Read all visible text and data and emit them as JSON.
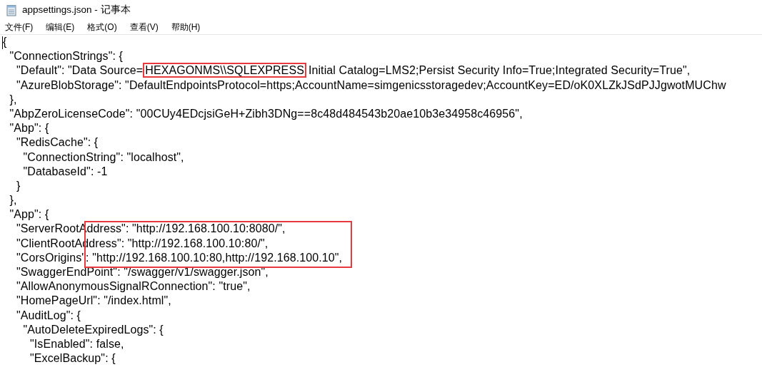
{
  "window": {
    "title": "appsettings.json - 记事本"
  },
  "menu": [
    "文件(F)",
    "编辑(E)",
    "格式(O)",
    "查看(V)",
    "帮助(H)"
  ],
  "editor": {
    "lines": [
      {
        "text": "{",
        "children": [
          {
            "text": "\"ConnectionStrings\": {",
            "children": [
              {
                "segments": [
                  {
                    "text": "\"Default\": \"Data Source=",
                    "boxed": false
                  },
                  {
                    "text": "HEXAGONMS\\\\SQLEXPRESS",
                    "boxed": true
                  },
                  {
                    "text": "Initial Catalog=LMS2;Persist Security Info=True;Integrated Security=True\",",
                    "boxed": false
                  }
                ]
              },
              {
                "text": "\"AzureBlobStorage\": \"DefaultEndpointsProtocol=https;AccountName=simgenicsstoragedev;AccountKey=ED/oK0XLZkJSdPJJgwotMUChw"
              }
            ]
          },
          {
            "text": "},"
          },
          {
            "text": "\"AbpZeroLicenseCode\": \"00CUy4EDcjsiGeH+Zibh3DNg==8c48d484543b20ae10b3e34958c46956\","
          },
          {
            "text": "\"Abp\": {",
            "children": [
              {
                "text": "\"RedisCache\": {",
                "children": [
                  {
                    "text": "\"ConnectionString\": \"localhost\","
                  },
                  {
                    "text": "\"DatabaseId\": -1"
                  }
                ]
              },
              {
                "text": "}"
              }
            ]
          },
          {
            "text": "},"
          },
          {
            "text": "\"App\": {",
            "children": [
              {
                "text": "\"ServerRootAddress\": \"http://192.168.100.10:8080/\",",
                "in_box": true
              },
              {
                "text": "\"ClientRootAddress\": \"http://192.168.100.10:80/\",",
                "in_box": true
              },
              {
                "text": "\"CorsOrigins\": \"http://192.168.100.10:80,http://192.168.100.10\",",
                "in_box": true
              },
              {
                "text": "\"SwaggerEndPoint\": \"/swagger/v1/swagger.json\","
              },
              {
                "text": "\"AllowAnonymousSignalRConnection\": \"true\","
              },
              {
                "text": "\"HomePageUrl\": \"/index.html\","
              },
              {
                "text": "\"AuditLog\": {",
                "children": [
                  {
                    "text": "\"AutoDeleteExpiredLogs\": {",
                    "children": [
                      {
                        "text": "\"IsEnabled\": false,"
                      },
                      {
                        "text": "\"ExcelBackup\": {"
                      }
                    ]
                  }
                ]
              }
            ]
          }
        ]
      }
    ]
  }
}
